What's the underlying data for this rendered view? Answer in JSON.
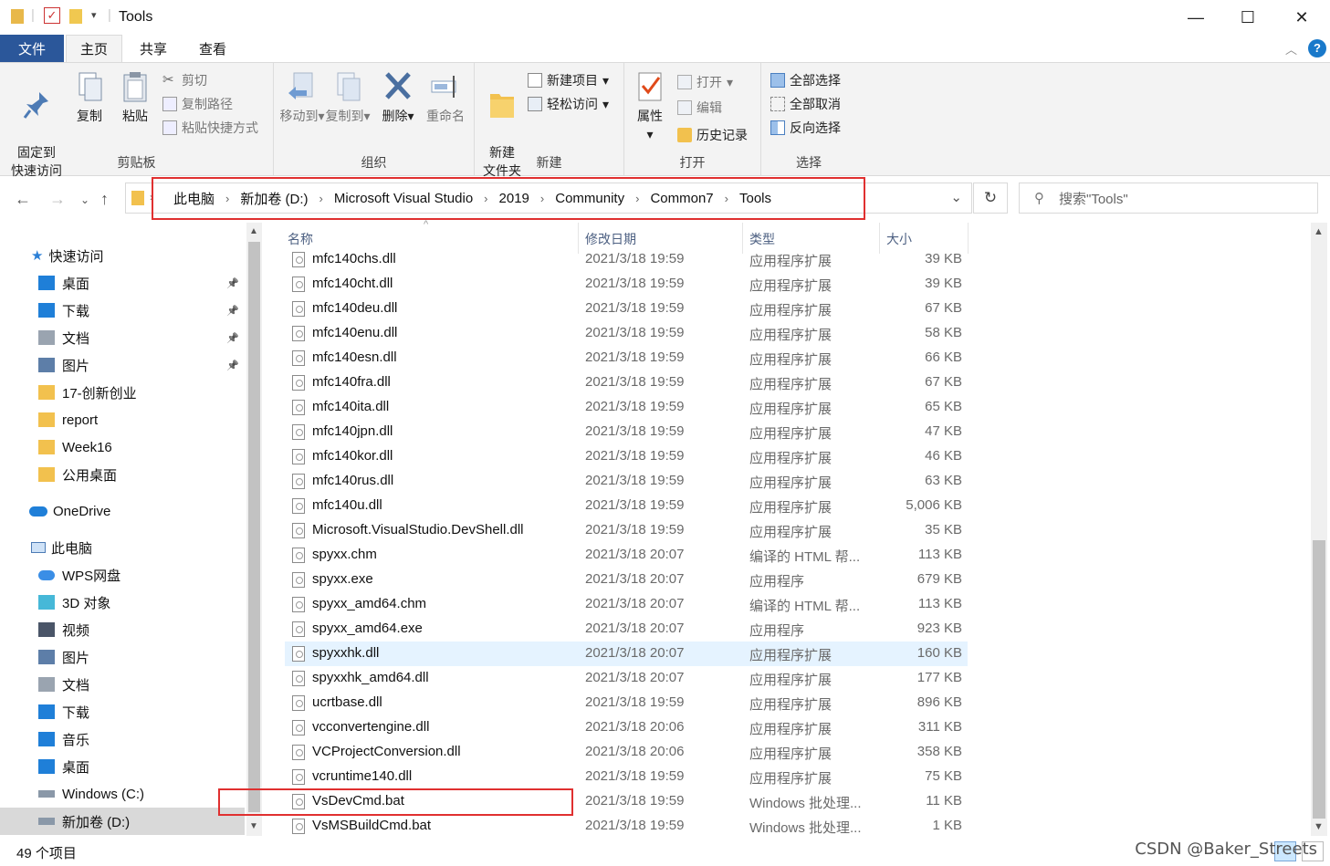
{
  "window": {
    "title": "Tools",
    "minimize": "—",
    "maximize": "☐",
    "close": "✕"
  },
  "ribbon_tabs": [
    "文件",
    "主页",
    "共享",
    "查看"
  ],
  "ribbon": {
    "clipboard": {
      "label": "剪贴板",
      "pin": "固定到\n快速访问",
      "copy": "复制",
      "paste": "粘贴",
      "cut": "剪切",
      "copy_path": "复制路径",
      "paste_shortcut": "粘贴快捷方式"
    },
    "organize": {
      "label": "组织",
      "move_to": "移动到",
      "copy_to": "复制到",
      "delete": "删除",
      "rename": "重命名"
    },
    "new": {
      "label": "新建",
      "new_folder": "新建\n文件夹",
      "new_item": "新建项目",
      "easy_access": "轻松访问"
    },
    "open": {
      "label": "打开",
      "properties": "属性",
      "open": "打开",
      "edit": "编辑",
      "history": "历史记录"
    },
    "select": {
      "label": "选择",
      "select_all": "全部选择",
      "select_none": "全部取消",
      "invert": "反向选择"
    }
  },
  "address": {
    "crumbs": [
      "此电脑",
      "新加卷 (D:)",
      "Microsoft Visual Studio",
      "2019",
      "Community",
      "Common7",
      "Tools"
    ],
    "search_placeholder": "搜索\"Tools\""
  },
  "nav": {
    "quick_access": "快速访问",
    "items": [
      {
        "label": "桌面",
        "icon": "desktop-icon",
        "pinned": true
      },
      {
        "label": "下载",
        "icon": "download-icon",
        "pinned": true
      },
      {
        "label": "文档",
        "icon": "document-icon",
        "pinned": true
      },
      {
        "label": "图片",
        "icon": "picture-icon",
        "pinned": true
      },
      {
        "label": "17-创新创业",
        "icon": "folder-icon"
      },
      {
        "label": "report",
        "icon": "folder-icon"
      },
      {
        "label": "Week16",
        "icon": "folder-icon"
      },
      {
        "label": "公用桌面",
        "icon": "folder-icon"
      }
    ],
    "onedrive": "OneDrive",
    "this_pc": "此电脑",
    "pc_items": [
      {
        "label": "WPS网盘",
        "icon": "cloud-icon"
      },
      {
        "label": "3D 对象",
        "icon": "cube-icon"
      },
      {
        "label": "视频",
        "icon": "video-icon"
      },
      {
        "label": "图片",
        "icon": "picture-icon"
      },
      {
        "label": "文档",
        "icon": "document-icon"
      },
      {
        "label": "下载",
        "icon": "download-icon"
      },
      {
        "label": "音乐",
        "icon": "music-icon"
      },
      {
        "label": "桌面",
        "icon": "desktop-icon"
      },
      {
        "label": "Windows (C:)",
        "icon": "drive-icon"
      },
      {
        "label": "新加卷 (D:)",
        "icon": "drive-icon"
      }
    ]
  },
  "columns": [
    "名称",
    "修改日期",
    "类型",
    "大小"
  ],
  "files": [
    {
      "name": "mfc140chs.dll",
      "date": "2021/3/18 19:59",
      "type": "应用程序扩展",
      "size": "39 KB"
    },
    {
      "name": "mfc140cht.dll",
      "date": "2021/3/18 19:59",
      "type": "应用程序扩展",
      "size": "39 KB"
    },
    {
      "name": "mfc140deu.dll",
      "date": "2021/3/18 19:59",
      "type": "应用程序扩展",
      "size": "67 KB"
    },
    {
      "name": "mfc140enu.dll",
      "date": "2021/3/18 19:59",
      "type": "应用程序扩展",
      "size": "58 KB"
    },
    {
      "name": "mfc140esn.dll",
      "date": "2021/3/18 19:59",
      "type": "应用程序扩展",
      "size": "66 KB"
    },
    {
      "name": "mfc140fra.dll",
      "date": "2021/3/18 19:59",
      "type": "应用程序扩展",
      "size": "67 KB"
    },
    {
      "name": "mfc140ita.dll",
      "date": "2021/3/18 19:59",
      "type": "应用程序扩展",
      "size": "65 KB"
    },
    {
      "name": "mfc140jpn.dll",
      "date": "2021/3/18 19:59",
      "type": "应用程序扩展",
      "size": "47 KB"
    },
    {
      "name": "mfc140kor.dll",
      "date": "2021/3/18 19:59",
      "type": "应用程序扩展",
      "size": "46 KB"
    },
    {
      "name": "mfc140rus.dll",
      "date": "2021/3/18 19:59",
      "type": "应用程序扩展",
      "size": "63 KB"
    },
    {
      "name": "mfc140u.dll",
      "date": "2021/3/18 19:59",
      "type": "应用程序扩展",
      "size": "5,006 KB"
    },
    {
      "name": "Microsoft.VisualStudio.DevShell.dll",
      "date": "2021/3/18 19:59",
      "type": "应用程序扩展",
      "size": "35 KB"
    },
    {
      "name": "spyxx.chm",
      "date": "2021/3/18 20:07",
      "type": "编译的 HTML 帮...",
      "size": "113 KB"
    },
    {
      "name": "spyxx.exe",
      "date": "2021/3/18 20:07",
      "type": "应用程序",
      "size": "679 KB"
    },
    {
      "name": "spyxx_amd64.chm",
      "date": "2021/3/18 20:07",
      "type": "编译的 HTML 帮...",
      "size": "113 KB"
    },
    {
      "name": "spyxx_amd64.exe",
      "date": "2021/3/18 20:07",
      "type": "应用程序",
      "size": "923 KB"
    },
    {
      "name": "spyxxhk.dll",
      "date": "2021/3/18 20:07",
      "type": "应用程序扩展",
      "size": "160 KB"
    },
    {
      "name": "spyxxhk_amd64.dll",
      "date": "2021/3/18 20:07",
      "type": "应用程序扩展",
      "size": "177 KB"
    },
    {
      "name": "ucrtbase.dll",
      "date": "2021/3/18 19:59",
      "type": "应用程序扩展",
      "size": "896 KB"
    },
    {
      "name": "vcconvertengine.dll",
      "date": "2021/3/18 20:06",
      "type": "应用程序扩展",
      "size": "311 KB"
    },
    {
      "name": "VCProjectConversion.dll",
      "date": "2021/3/18 20:06",
      "type": "应用程序扩展",
      "size": "358 KB"
    },
    {
      "name": "vcruntime140.dll",
      "date": "2021/3/18 19:59",
      "type": "应用程序扩展",
      "size": "75 KB"
    },
    {
      "name": "VsDevCmd.bat",
      "date": "2021/3/18 19:59",
      "type": "Windows 批处理...",
      "size": "11 KB"
    },
    {
      "name": "VsMSBuildCmd.bat",
      "date": "2021/3/18 19:59",
      "type": "Windows 批处理...",
      "size": "1 KB"
    }
  ],
  "status": {
    "item_count": "49 个项目"
  },
  "watermark": "CSDN @Baker_Streets",
  "colors": {
    "accent": "#2b579a",
    "highlight": "#e03030",
    "selection": "#cce8ff"
  }
}
